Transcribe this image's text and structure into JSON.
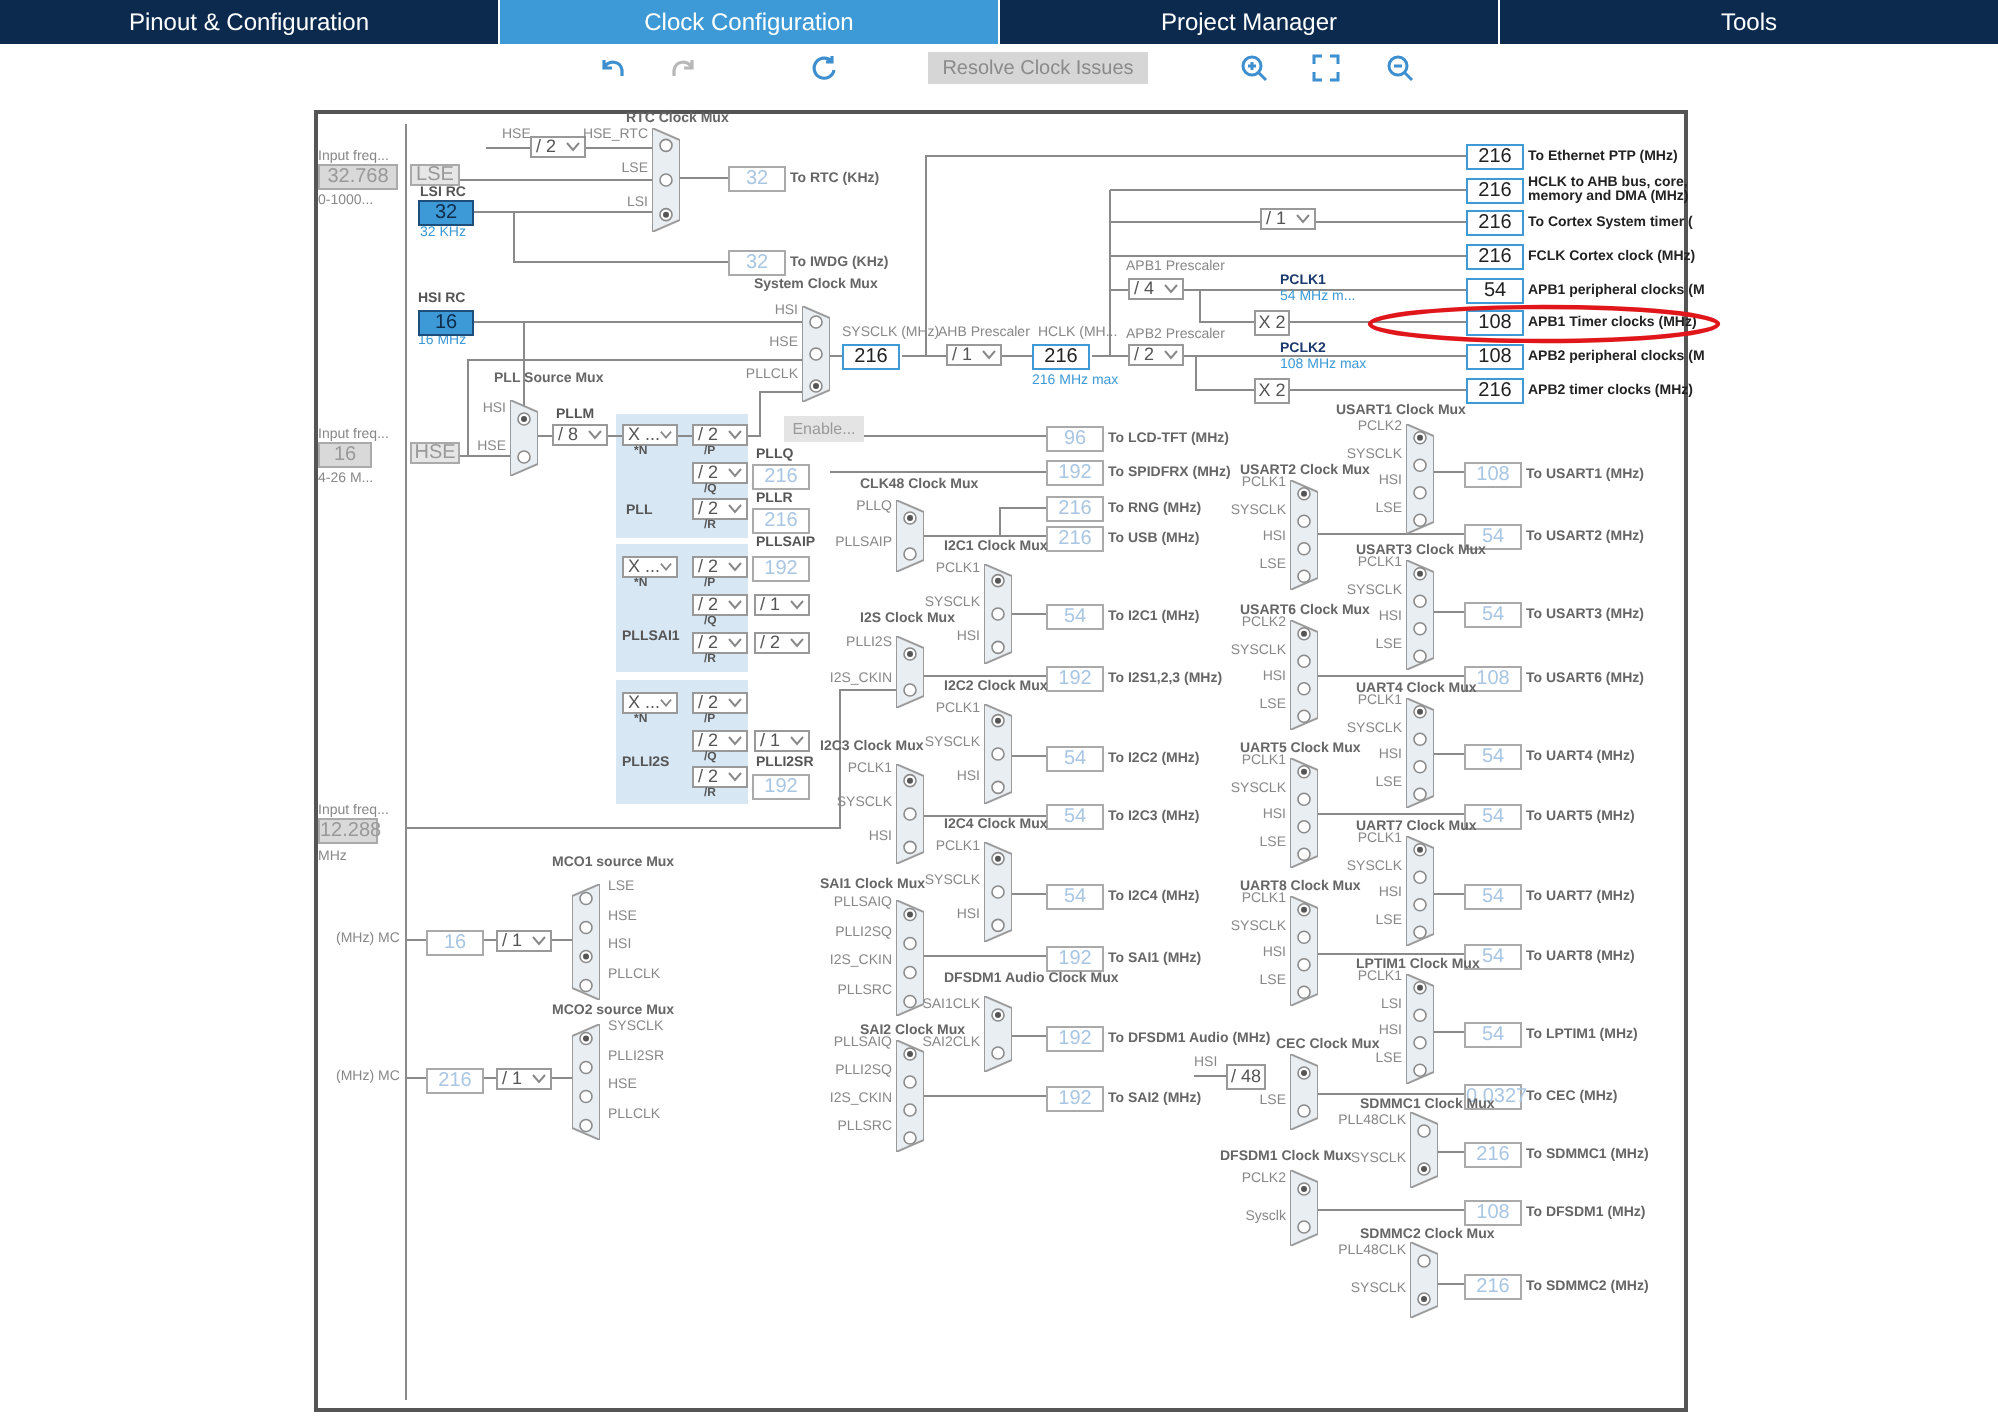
{
  "tabs": [
    {
      "label": "Pinout & Configuration",
      "selected": false
    },
    {
      "label": "Clock Configuration",
      "selected": true
    },
    {
      "label": "Project Manager",
      "selected": false
    },
    {
      "label": "Tools",
      "selected": false
    }
  ],
  "toolbar": [
    {
      "kind": "undo",
      "disabled": false
    },
    {
      "kind": "redo",
      "disabled": true
    },
    {
      "kind": "reset",
      "disabled": false
    },
    {
      "kind": "resolve",
      "label": "Resolve Clock Issues",
      "disabled": true
    },
    {
      "kind": "zoom_in",
      "disabled": false
    },
    {
      "kind": "fit",
      "disabled": false
    },
    {
      "kind": "zoom_out",
      "disabled": false
    }
  ],
  "diagram": {
    "labels": [
      {
        "text": "HSE",
        "kind": "plain"
      },
      {
        "text": "Input freq...",
        "kind": "plain"
      },
      {
        "text": "LSI RC",
        "kind": "bold"
      },
      {
        "text": "0-1000...",
        "kind": "plain"
      },
      {
        "text": "32 KHz",
        "kind": "blue"
      },
      {
        "text": "APB1 Prescaler",
        "kind": "plain"
      },
      {
        "text": "PCLK1",
        "kind": "navy"
      },
      {
        "text": "54 MHz m...",
        "kind": "blue"
      },
      {
        "text": "HSI RC",
        "kind": "bold"
      },
      {
        "text": "SYSCLK (MHz)",
        "kind": "plain"
      },
      {
        "text": "AHB Prescaler",
        "kind": "plain"
      },
      {
        "text": "HCLK (MH...",
        "kind": "plain"
      },
      {
        "text": "APB2 Prescaler",
        "kind": "plain"
      },
      {
        "text": "16 MHz",
        "kind": "blue"
      },
      {
        "text": "PCLK2",
        "kind": "navy"
      },
      {
        "text": "108 MHz max",
        "kind": "blue"
      },
      {
        "text": "216 MHz max",
        "kind": "blue"
      },
      {
        "text": "PLLM",
        "kind": "bold"
      },
      {
        "text": "Input freq...",
        "kind": "plain"
      },
      {
        "text": "PLLQ",
        "kind": "bold"
      },
      {
        "text": "4-26 M...",
        "kind": "plain"
      },
      {
        "text": "PLLR",
        "kind": "bold"
      },
      {
        "text": "PLL",
        "kind": "bold"
      },
      {
        "text": "PLLSAIP",
        "kind": "bold"
      },
      {
        "text": "PLLSAI1",
        "kind": "bold"
      },
      {
        "text": "PLLI2SR",
        "kind": "bold"
      },
      {
        "text": "PLLI2S",
        "kind": "bold"
      },
      {
        "text": "Input freq...",
        "kind": "plain"
      },
      {
        "text": "MHz",
        "kind": "plain"
      },
      {
        "text": "(MHz) MC",
        "kind": "plain"
      },
      {
        "text": "HSI",
        "kind": "plain"
      },
      {
        "text": "(MHz) MC",
        "kind": "plain"
      }
    ],
    "boxes": [
      {
        "kind": "input",
        "value": "32.768"
      },
      {
        "kind": "source",
        "value": "LSE"
      },
      {
        "kind": "oscillator",
        "value": "32"
      },
      {
        "kind": "oscillator",
        "value": "16"
      },
      {
        "kind": "multiplier",
        "value": "X 2"
      },
      {
        "kind": "multiplier",
        "value": "X 2"
      },
      {
        "kind": "button",
        "value": "Enable..."
      },
      {
        "kind": "input",
        "value": "16"
      },
      {
        "kind": "source",
        "value": "HSE"
      },
      {
        "kind": "input",
        "value": "12.288"
      },
      {
        "kind": "multiplier",
        "value": "/ 48"
      }
    ],
    "dropdowns": [
      {
        "value": "/ 2"
      },
      {
        "value": "/ 8"
      },
      {
        "value": "X ...",
        "caption": "*N"
      },
      {
        "value": "/ 2",
        "caption": "/P"
      },
      {
        "value": "/ 2",
        "caption": "/Q"
      },
      {
        "value": "/ 2",
        "caption": "/R"
      },
      {
        "value": "X ...",
        "caption": "*N"
      },
      {
        "value": "/ 2",
        "caption": "/P"
      },
      {
        "value": "/ 2",
        "caption": "/Q"
      },
      {
        "value": "/ 1"
      },
      {
        "value": "/ 2",
        "caption": "/R"
      },
      {
        "value": "/ 2"
      },
      {
        "value": "X ...",
        "caption": "*N"
      },
      {
        "value": "/ 2",
        "caption": "/P"
      },
      {
        "value": "/ 2",
        "caption": "/Q"
      },
      {
        "value": "/ 1"
      },
      {
        "value": "/ 2",
        "caption": "/R"
      },
      {
        "value": "/ 1"
      },
      {
        "value": "/ 4"
      },
      {
        "value": "/ 2"
      },
      {
        "value": "/ 1"
      },
      {
        "value": "/ 1"
      },
      {
        "value": "/ 1"
      }
    ],
    "outputs": [
      {
        "value": "216",
        "label": "To Ethernet PTP (MHz)",
        "active": true
      },
      {
        "value": "216",
        "label": "HCLK to AHB bus, core, memory and DMA (MHz)",
        "active": true
      },
      {
        "value": "216",
        "label": "To Cortex System timer (",
        "active": true
      },
      {
        "value": "216",
        "label": "FCLK Cortex clock (MHz)",
        "active": true
      },
      {
        "value": "54",
        "label": "APB1 peripheral clocks (M",
        "active": true
      },
      {
        "value": "108",
        "label": "APB1 Timer clocks (MHz)",
        "active": true
      },
      {
        "value": "108",
        "label": "APB2 peripheral clocks (M",
        "active": true
      },
      {
        "value": "216",
        "label": "APB2 timer clocks (MHz)",
        "active": true
      },
      {
        "value": "216",
        "active": true
      },
      {
        "value": "216",
        "active": true
      },
      {
        "value": "32",
        "label": "To RTC (KHz)",
        "active": false
      },
      {
        "value": "32",
        "label": "To IWDG (KHz)",
        "active": false
      },
      {
        "value": "216",
        "active": false
      },
      {
        "value": "216",
        "active": false
      },
      {
        "value": "192",
        "active": false
      },
      {
        "value": "192",
        "active": false
      },
      {
        "value": "16",
        "active": false
      },
      {
        "value": "216",
        "active": false
      },
      {
        "value": "96",
        "label": "To LCD-TFT (MHz)",
        "active": false
      },
      {
        "value": "192",
        "label": "To SPIDFRX (MHz)",
        "active": false
      },
      {
        "value": "216",
        "label": "To RNG (MHz)",
        "active": false
      },
      {
        "value": "216",
        "label": "To USB (MHz)",
        "active": false
      },
      {
        "value": "54",
        "label": "To I2C1 (MHz)",
        "active": false
      },
      {
        "value": "192",
        "label": "To I2S1,2,3 (MHz)",
        "active": false
      },
      {
        "value": "54",
        "label": "To I2C2 (MHz)",
        "active": false
      },
      {
        "value": "54",
        "label": "To I2C3 (MHz)",
        "active": false
      },
      {
        "value": "54",
        "label": "To I2C4 (MHz)",
        "active": false
      },
      {
        "value": "192",
        "label": "To SAI1 (MHz)",
        "active": false
      },
      {
        "value": "192",
        "label": "To DFSDM1 Audio (MHz)",
        "active": false
      },
      {
        "value": "192",
        "label": "To SAI2 (MHz)",
        "active": false
      },
      {
        "value": "108",
        "label": "To USART1 (MHz)",
        "active": false
      },
      {
        "value": "54",
        "label": "To USART2 (MHz)",
        "active": false
      },
      {
        "value": "54",
        "label": "To USART3 (MHz)",
        "active": false
      },
      {
        "value": "108",
        "label": "To USART6 (MHz)",
        "active": false
      },
      {
        "value": "54",
        "label": "To UART4 (MHz)",
        "active": false
      },
      {
        "value": "54",
        "label": "To UART5 (MHz)",
        "active": false
      },
      {
        "value": "54",
        "label": "To UART7 (MHz)",
        "active": false
      },
      {
        "value": "54",
        "label": "To UART8 (MHz)",
        "active": false
      },
      {
        "value": "54",
        "label": "To LPTIM1 (MHz)",
        "active": false
      },
      {
        "value": "0.0327",
        "label": "To CEC (MHz)",
        "active": false
      },
      {
        "value": "216",
        "label": "To SDMMC1 (MHz)",
        "active": false
      },
      {
        "value": "108",
        "label": "To DFSDM1 (MHz)",
        "active": false
      },
      {
        "value": "216",
        "label": "To SDMMC2 (MHz)",
        "active": false
      }
    ],
    "muxes": [
      {
        "title": "RTC Clock Mux",
        "kind": "forward",
        "inputs": [
          {
            "label": "HSE_RTC",
            "selected": false
          },
          {
            "label": "LSE",
            "selected": false
          },
          {
            "label": "LSI",
            "selected": true
          }
        ]
      },
      {
        "title": "System Clock Mux",
        "kind": "forward",
        "inputs": [
          {
            "label": "HSI",
            "selected": false
          },
          {
            "label": "HSE",
            "selected": false
          },
          {
            "label": "PLLCLK",
            "selected": true
          }
        ]
      },
      {
        "title": "PLL Source Mux",
        "kind": "forward",
        "inputs": [
          {
            "label": "HSI",
            "selected": true
          },
          {
            "label": "HSE",
            "selected": false
          }
        ]
      },
      {
        "title": "CLK48 Clock Mux",
        "kind": "forward",
        "inputs": [
          {
            "label": "PLLQ",
            "selected": true
          },
          {
            "label": "PLLSAIP",
            "selected": false
          }
        ]
      },
      {
        "title": "I2C1 Clock Mux",
        "kind": "forward",
        "inputs": [
          {
            "label": "PCLK1",
            "selected": true
          },
          {
            "label": "SYSCLK",
            "selected": false
          },
          {
            "label": "HSI",
            "selected": false
          }
        ]
      },
      {
        "title": "I2S Clock Mux",
        "kind": "forward",
        "inputs": [
          {
            "label": "PLLI2S",
            "selected": true
          },
          {
            "label": "I2S_CKIN",
            "selected": false
          }
        ]
      },
      {
        "title": "I2C2 Clock Mux",
        "kind": "forward",
        "inputs": [
          {
            "label": "PCLK1",
            "selected": true
          },
          {
            "label": "SYSCLK",
            "selected": false
          },
          {
            "label": "HSI",
            "selected": false
          }
        ]
      },
      {
        "title": "I2C3 Clock Mux",
        "kind": "forward",
        "inputs": [
          {
            "label": "PCLK1",
            "selected": true
          },
          {
            "label": "SYSCLK",
            "selected": false
          },
          {
            "label": "HSI",
            "selected": false
          }
        ]
      },
      {
        "title": "I2C4 Clock Mux",
        "kind": "forward",
        "inputs": [
          {
            "label": "PCLK1",
            "selected": true
          },
          {
            "label": "SYSCLK",
            "selected": false
          },
          {
            "label": "HSI",
            "selected": false
          }
        ]
      },
      {
        "title": "SAI1 Clock Mux",
        "kind": "forward",
        "inputs": [
          {
            "label": "PLLSAIQ",
            "selected": true
          },
          {
            "label": "PLLI2SQ",
            "selected": false
          },
          {
            "label": "I2S_CKIN",
            "selected": false
          },
          {
            "label": "PLLSRC",
            "selected": false
          }
        ]
      },
      {
        "title": "DFSDM1 Audio Clock Mux",
        "kind": "forward",
        "inputs": [
          {
            "label": "SAI1CLK",
            "selected": true
          },
          {
            "label": "SAI2CLK",
            "selected": false
          }
        ]
      },
      {
        "title": "SAI2 Clock Mux",
        "kind": "forward",
        "inputs": [
          {
            "label": "PLLSAIQ",
            "selected": true
          },
          {
            "label": "PLLI2SQ",
            "selected": false
          },
          {
            "label": "I2S_CKIN",
            "selected": false
          },
          {
            "label": "PLLSRC",
            "selected": false
          }
        ]
      },
      {
        "title": "USART1 Clock Mux",
        "kind": "forward",
        "inputs": [
          {
            "label": "PCLK2",
            "selected": true
          },
          {
            "label": "SYSCLK",
            "selected": false
          },
          {
            "label": "HSI",
            "selected": false
          },
          {
            "label": "LSE",
            "selected": false
          }
        ]
      },
      {
        "title": "USART2 Clock Mux",
        "kind": "forward",
        "inputs": [
          {
            "label": "PCLK1",
            "selected": true
          },
          {
            "label": "SYSCLK",
            "selected": false
          },
          {
            "label": "HSI",
            "selected": false
          },
          {
            "label": "LSE",
            "selected": false
          }
        ]
      },
      {
        "title": "USART3 Clock Mux",
        "kind": "forward",
        "inputs": [
          {
            "label": "PCLK1",
            "selected": true
          },
          {
            "label": "SYSCLK",
            "selected": false
          },
          {
            "label": "HSI",
            "selected": false
          },
          {
            "label": "LSE",
            "selected": false
          }
        ]
      },
      {
        "title": "USART6 Clock Mux",
        "kind": "forward",
        "inputs": [
          {
            "label": "PCLK2",
            "selected": true
          },
          {
            "label": "SYSCLK",
            "selected": false
          },
          {
            "label": "HSI",
            "selected": false
          },
          {
            "label": "LSE",
            "selected": false
          }
        ]
      },
      {
        "title": "UART4 Clock Mux",
        "kind": "forward",
        "inputs": [
          {
            "label": "PCLK1",
            "selected": true
          },
          {
            "label": "SYSCLK",
            "selected": false
          },
          {
            "label": "HSI",
            "selected": false
          },
          {
            "label": "LSE",
            "selected": false
          }
        ]
      },
      {
        "title": "UART5 Clock Mux",
        "kind": "forward",
        "inputs": [
          {
            "label": "PCLK1",
            "selected": true
          },
          {
            "label": "SYSCLK",
            "selected": false
          },
          {
            "label": "HSI",
            "selected": false
          },
          {
            "label": "LSE",
            "selected": false
          }
        ]
      },
      {
        "title": "UART7 Clock Mux",
        "kind": "forward",
        "inputs": [
          {
            "label": "PCLK1",
            "selected": true
          },
          {
            "label": "SYSCLK",
            "selected": false
          },
          {
            "label": "HSI",
            "selected": false
          },
          {
            "label": "LSE",
            "selected": false
          }
        ]
      },
      {
        "title": "UART8 Clock Mux",
        "kind": "forward",
        "inputs": [
          {
            "label": "PCLK1",
            "selected": true
          },
          {
            "label": "SYSCLK",
            "selected": false
          },
          {
            "label": "HSI",
            "selected": false
          },
          {
            "label": "LSE",
            "selected": false
          }
        ]
      },
      {
        "title": "LPTIM1 Clock Mux",
        "kind": "forward",
        "inputs": [
          {
            "label": "PCLK1",
            "selected": true
          },
          {
            "label": "LSI",
            "selected": false
          },
          {
            "label": "HSI",
            "selected": false
          },
          {
            "label": "LSE",
            "selected": false
          }
        ]
      },
      {
        "title": "CEC Clock Mux",
        "kind": "forward",
        "inputs": [
          {
            "selected": true
          },
          {
            "label": "LSE",
            "selected": false
          }
        ]
      },
      {
        "title": "SDMMC1 Clock Mux",
        "kind": "forward",
        "inputs": [
          {
            "label": "PLL48CLK",
            "selected": false
          },
          {
            "label": "SYSCLK",
            "selected": true
          }
        ]
      },
      {
        "title": "DFSDM1 Clock Mux",
        "kind": "forward",
        "inputs": [
          {
            "label": "PCLK2",
            "selected": true
          },
          {
            "label": "Sysclk",
            "selected": false
          }
        ]
      },
      {
        "title": "SDMMC2 Clock Mux",
        "kind": "forward",
        "inputs": [
          {
            "label": "PLL48CLK",
            "selected": false
          },
          {
            "label": "SYSCLK",
            "selected": true
          }
        ]
      },
      {
        "title": "MCO1 source Mux",
        "kind": "backward",
        "inputs": [
          {
            "label": "LSE",
            "selected": false
          },
          {
            "label": "HSE",
            "selected": false
          },
          {
            "label": "HSI",
            "selected": true
          },
          {
            "label": "PLLCLK",
            "selected": false
          }
        ]
      },
      {
        "title": "MCO2 source Mux",
        "kind": "backward",
        "inputs": [
          {
            "label": "SYSCLK",
            "selected": true
          },
          {
            "label": "PLLI2SR",
            "selected": false
          },
          {
            "label": "HSE",
            "selected": false
          },
          {
            "label": "PLLCLK",
            "selected": false
          }
        ]
      }
    ],
    "annotation": {
      "kind": "ellipse"
    }
  }
}
